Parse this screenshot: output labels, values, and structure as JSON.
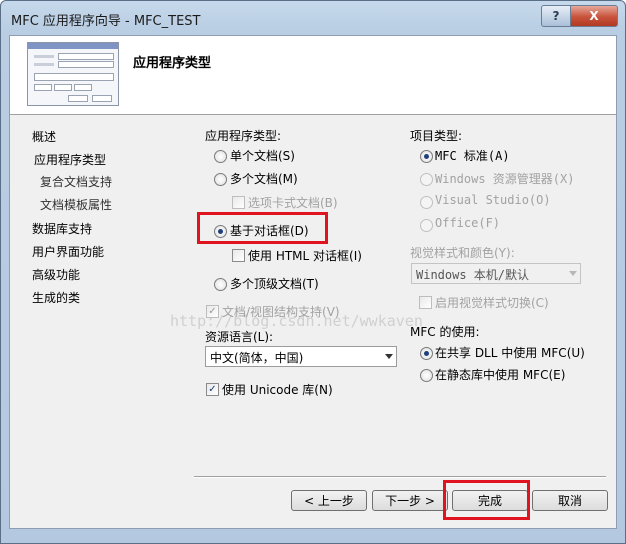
{
  "window": {
    "title": "MFC 应用程序向导 - MFC_TEST",
    "help_label": "?",
    "close_label": "X"
  },
  "header": {
    "title": "应用程序类型"
  },
  "nav": {
    "items": [
      "概述",
      "应用程序类型",
      "复合文档支持",
      "文档模板属性",
      "数据库支持",
      "用户界面功能",
      "高级功能",
      "生成的类"
    ]
  },
  "app_type": {
    "label": "应用程序类型:",
    "single_doc": "单个文档(S)",
    "multi_doc": "多个文档(M)",
    "tabbed_docs": "选项卡式文档(B)",
    "dialog_based": "基于对话框(D)",
    "use_html_dialog": "使用 HTML 对话框(I)",
    "multi_toplevel": "多个顶级文档(T)",
    "doc_view_support": "文档/视图结构支持(V)"
  },
  "resource_lang": {
    "label": "资源语言(L):",
    "value": "中文(简体，中国)"
  },
  "unicode": {
    "label": "使用 Unicode 库(N)",
    "checked": "✓"
  },
  "project_type": {
    "label": "项目类型:",
    "mfc_standard": "MFC 标准(A)",
    "windows_explorer": "Windows 资源管理器(X)",
    "visual_studio": "Visual Studio(O)",
    "office": "Office(F)"
  },
  "visual_style": {
    "label": "视觉样式和颜色(Y):",
    "value": "Windows 本机/默认",
    "enable_switch": "启用视觉样式切换(C)"
  },
  "mfc_use": {
    "label": "MFC 的使用:",
    "shared_dll": "在共享 DLL 中使用 MFC(U)",
    "static_lib": "在静态库中使用 MFC(E)"
  },
  "buttons": {
    "prev": "< 上一步",
    "next": "下一步 >",
    "finish": "完成",
    "cancel": "取消"
  },
  "watermark": "http://blog.csdn.net/wwkaven",
  "colors": {
    "highlight": "#e0141e",
    "dialog_bg": "#f0f0f0"
  }
}
